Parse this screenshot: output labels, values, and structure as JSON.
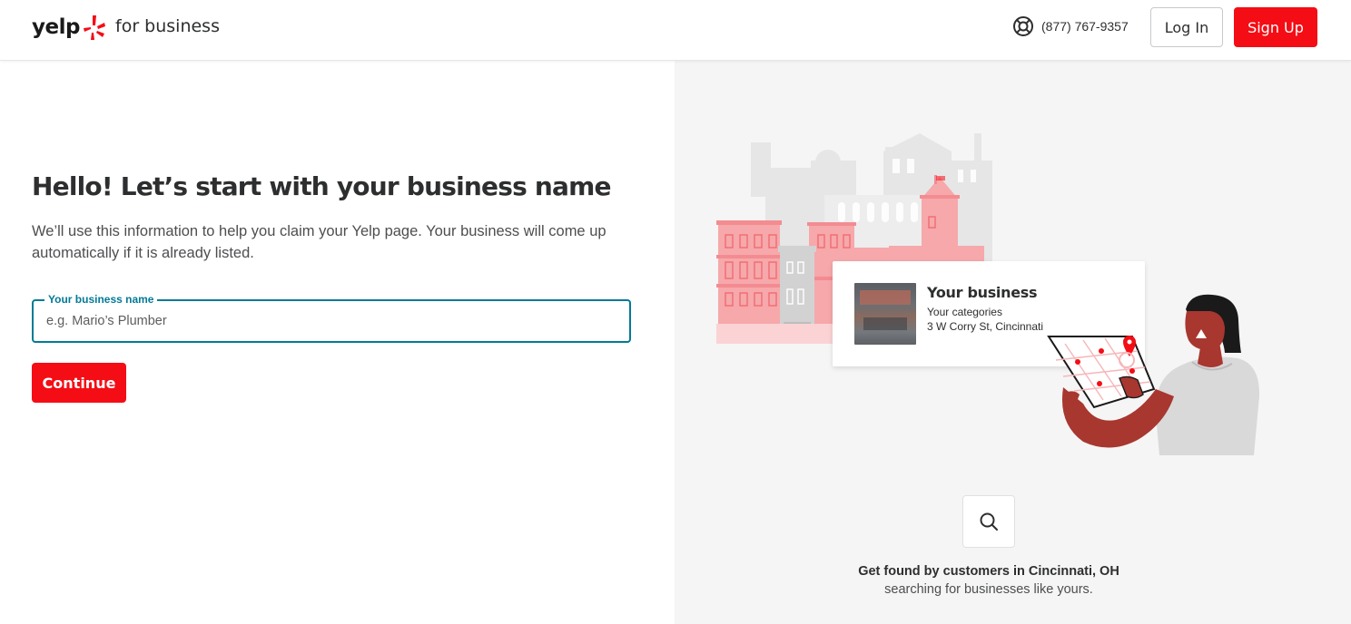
{
  "header": {
    "logo_text": "yelp",
    "logo_suffix": "for business",
    "phone": "(877) 767-9357",
    "support_icon": "lifebuoy-icon",
    "login_label": "Log In",
    "signup_label": "Sign Up"
  },
  "main": {
    "title": "Hello! Let’s start with your business name",
    "description": "We’ll use this information to help you claim your Yelp page. Your business will come up automatically if it is already listed.",
    "field": {
      "label": "Your business name",
      "placeholder": "e.g. Mario’s Plumber",
      "value": ""
    },
    "continue_label": "Continue"
  },
  "preview": {
    "business_name": "Your business",
    "categories": "Your categories",
    "address": "3 W Corry St, Cincinnati",
    "search_icon": "search-icon",
    "found_title": "Get found by customers in Cincinnati, OH",
    "found_subtitle": "searching for businesses like yours."
  },
  "colors": {
    "brand_red": "#f40d15",
    "field_accent": "#027a97",
    "panel_bg": "#f5f5f5"
  }
}
